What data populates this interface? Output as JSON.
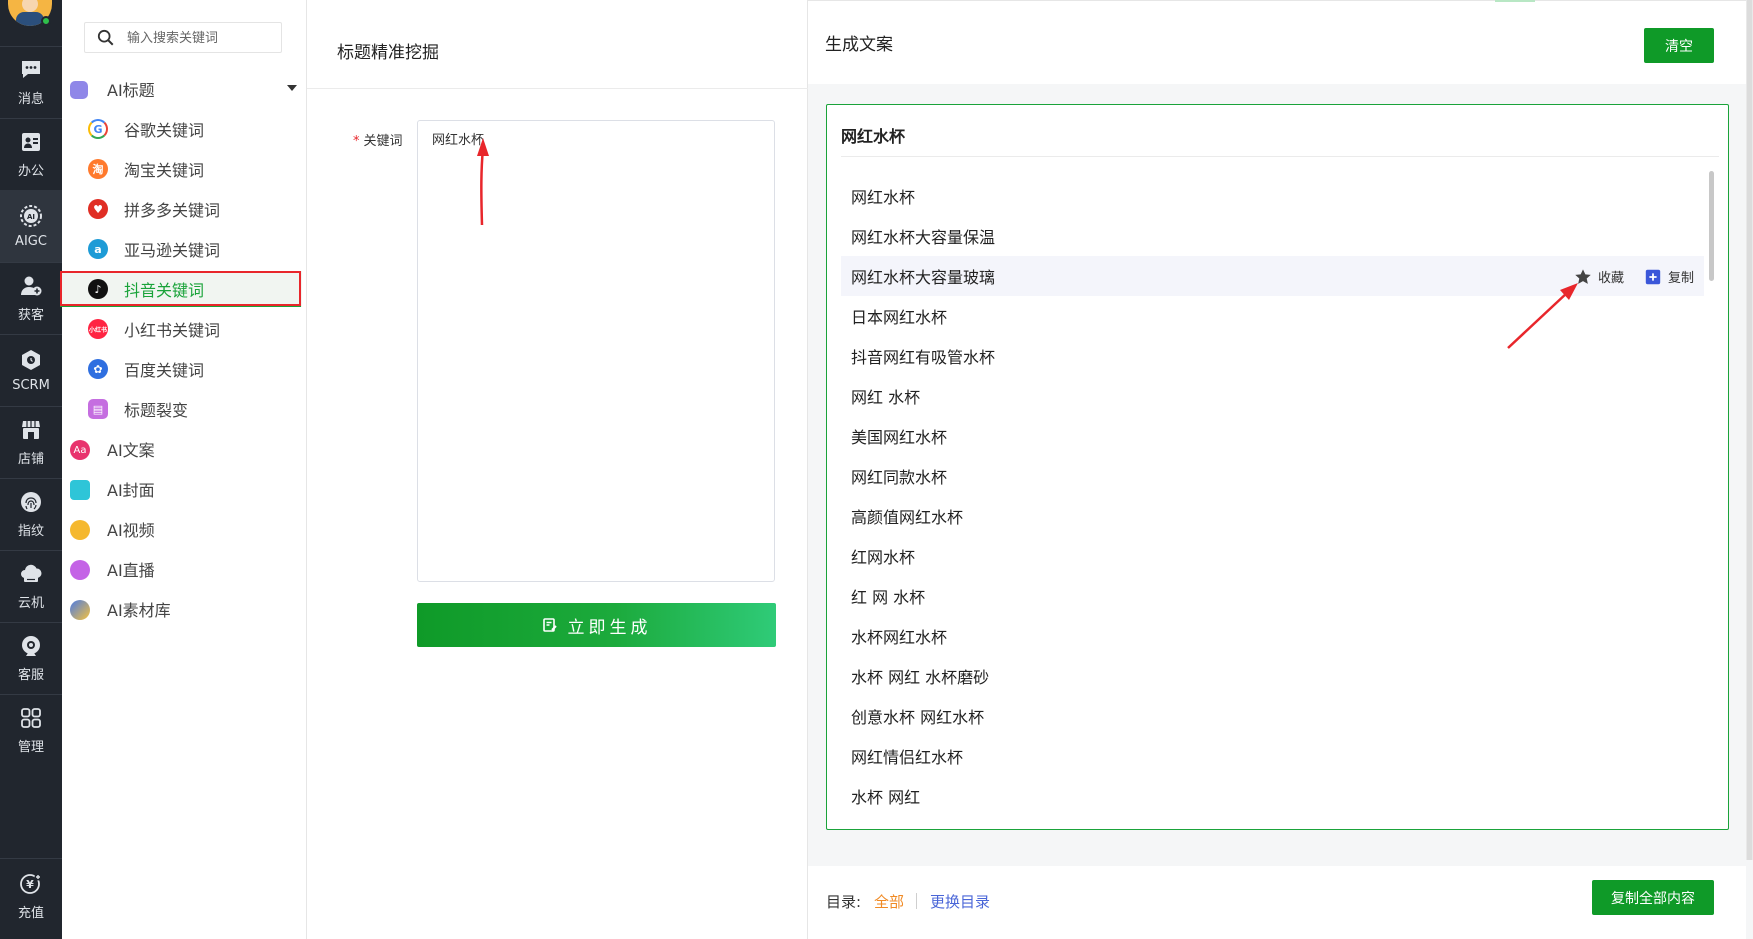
{
  "rail": {
    "items": [
      {
        "label": "消息",
        "icon": "chat-icon"
      },
      {
        "label": "办公",
        "icon": "office-icon"
      },
      {
        "label": "AIGC",
        "icon": "ai-icon"
      },
      {
        "label": "获客",
        "icon": "user-add-icon"
      },
      {
        "label": "SCRM",
        "icon": "scrm-icon"
      },
      {
        "label": "店铺",
        "icon": "shop-icon"
      },
      {
        "label": "指纹",
        "icon": "fingerprint-icon"
      },
      {
        "label": "云机",
        "icon": "cloud-phone-icon"
      },
      {
        "label": "客服",
        "icon": "service-icon"
      },
      {
        "label": "管理",
        "icon": "grid-icon"
      }
    ],
    "recharge_label": "充值"
  },
  "menu": {
    "search_placeholder": "输入搜索关键词",
    "ai_title": "AI标题",
    "sub_items": [
      {
        "label": "谷歌关键词",
        "icon": "google-icon"
      },
      {
        "label": "淘宝关键词",
        "icon": "taobao-icon"
      },
      {
        "label": "拼多多关键词",
        "icon": "pinduoduo-icon"
      },
      {
        "label": "亚马逊关键词",
        "icon": "amazon-icon"
      },
      {
        "label": "抖音关键词",
        "icon": "douyin-icon"
      },
      {
        "label": "小红书关键词",
        "icon": "xiaohongshu-icon",
        "badge": "小红书"
      },
      {
        "label": "百度关键词",
        "icon": "baidu-icon"
      },
      {
        "label": "标题裂变",
        "icon": "fission-icon"
      }
    ],
    "groups": [
      {
        "label": "AI文案",
        "icon": "copywriting-icon",
        "badge": "Aa"
      },
      {
        "label": "AI封面",
        "icon": "cover-icon"
      },
      {
        "label": "AI视频",
        "icon": "video-icon"
      },
      {
        "label": "AI直播",
        "icon": "live-icon"
      },
      {
        "label": "AI素材库",
        "icon": "library-icon"
      }
    ]
  },
  "form": {
    "panel_title": "标题精准挖掘",
    "required_mark": "*",
    "keyword_label": "关键词",
    "keyword_value": "网红水杯",
    "generate_label": "立即生成"
  },
  "result": {
    "panel_title": "生成文案",
    "clear_label": "清空",
    "box_title": "网红水杯",
    "rows": [
      "网红水杯",
      "网红水杯大容量保温",
      "网红水杯大容量玻璃",
      "日本网红水杯",
      "抖音网红有吸管水杯",
      "网红 水杯",
      "美国网红水杯",
      "网红同款水杯",
      "高颜值网红水杯",
      "红网水杯",
      "红 网 水杯",
      "水杯网红水杯",
      "水杯 网红 水杯磨砂",
      "创意水杯 网红水杯",
      "网红情侣红水杯",
      "水杯 网红"
    ],
    "collect_label": "收藏",
    "copy_label": "复制",
    "dir_label": "目录:",
    "dir_all": "全部",
    "dir_change": "更换目录",
    "copy_all_label": "复制全部内容"
  },
  "colors": {
    "brand_green": "#0f9a28",
    "annotation_red": "#e8262b",
    "rail_bg": "#21262e"
  }
}
